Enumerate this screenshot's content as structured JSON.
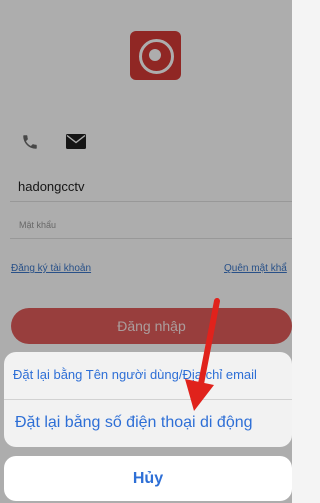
{
  "login": {
    "username": "hadongcctv",
    "password_placeholder": "Mật khẩu",
    "register_link": "Đăng ký tài khoản",
    "forgot_link": "Quên mật khẩ",
    "login_button": "Đăng nhập"
  },
  "icons": {
    "logo": "camera-logo-icon",
    "phone": "phone-icon",
    "email": "mail-icon"
  },
  "action_sheet": {
    "option_username_email": "Đặt lại bằng Tên người dùng/Địa chỉ email",
    "option_phone": "Đặt lại bằng số điện thoại di động",
    "cancel": "Hủy"
  },
  "colors": {
    "brand_red": "#d53a36",
    "link_blue": "#2e6fd6",
    "annotation_red": "#e0221c"
  }
}
